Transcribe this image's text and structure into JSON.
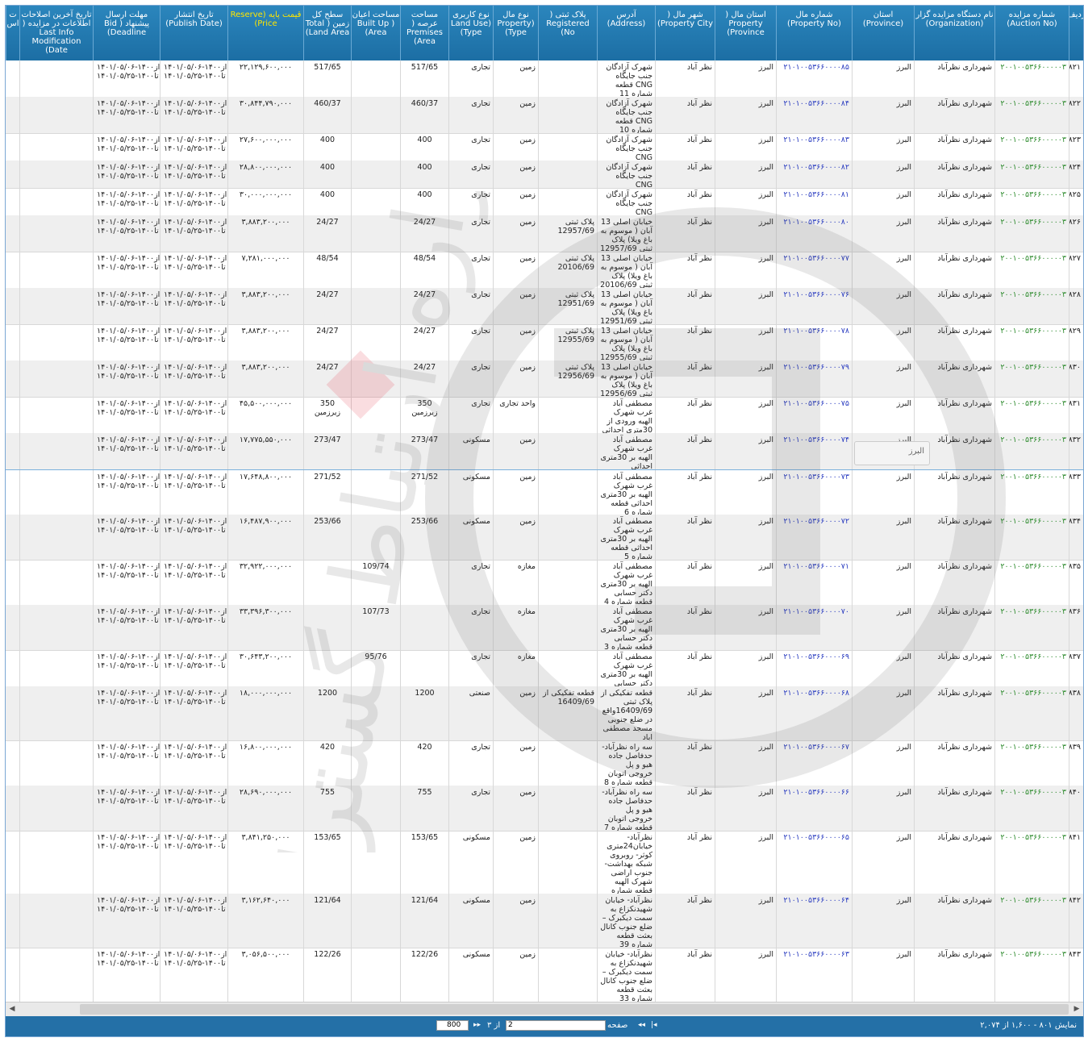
{
  "header": {
    "columns": [
      {
        "key": "radif",
        "label": "ردیف"
      },
      {
        "key": "auction_no",
        "label": "شماره مزایده (Auction No)"
      },
      {
        "key": "organization",
        "label": "نام دستگاه مزایده گزار (Organization)"
      },
      {
        "key": "province",
        "label": "استان (Province)"
      },
      {
        "key": "property_no",
        "label": "شماره مال (Property No)"
      },
      {
        "key": "property_province",
        "label": "استان مال ( Property Province)"
      },
      {
        "key": "property_city",
        "label": "شهر مال ( Property City)"
      },
      {
        "key": "address",
        "label": "آدرس (Address)"
      },
      {
        "key": "registered_no",
        "label": "پلاک ثبتی ( Registered No)"
      },
      {
        "key": "property_type",
        "label": "نوع مال (Property Type)"
      },
      {
        "key": "land_use",
        "label": "نوع کاربری (Land Use Type)"
      },
      {
        "key": "premises_area",
        "label": "مساحت عرصه ( Premises Area)"
      },
      {
        "key": "built_up_area",
        "label": "مساحت اعیان ( Built Up Area)"
      },
      {
        "key": "total_land_area",
        "label": "سطح کل زمین ( Total Land Area)"
      },
      {
        "key": "reserve_price",
        "label": "قیمت پایه (Reserve Price)"
      },
      {
        "key": "publish_date",
        "label": "تاریخ انتشار (Publish Date)"
      },
      {
        "key": "bid_deadline",
        "label": "مهلت ارسال پیشنهاد ( Bid Deadline)"
      },
      {
        "key": "last_modification",
        "label": "تاریخ آخرین اصلاحات اطلاعات در مزایده ( Last Info Modification Date)"
      },
      {
        "key": "extra",
        "label": "ت اس"
      }
    ]
  },
  "rows": [
    {
      "radif": "۸۲۱",
      "auction_no": "۲۰۰۱۰۰۵۳۶۶۰۰۰۰۰۳",
      "organization": "شهرداری نظرآباد",
      "province": "البرز",
      "property_no": "۲۱۰۱۰۰۵۳۶۶۰۰۰۰۸۵",
      "property_province": "البرز",
      "property_city": "نظر آباد",
      "address": "شهرک آزادگان جنب جایگاه CNG قطعه شماره 11",
      "registered_no": "",
      "property_type": "زمین",
      "land_use": "تجاری",
      "premises_area": "517/65",
      "built_up_area": "",
      "total_land_area": "517/65",
      "reserve_price": "۲۲,۱۲۹,۶۰۰,۰۰۰",
      "publish_date": "از۱۴۰۰-۱۴۰۱/۰۵/۰۶\nتا۱۴۰۰-۱۴۰۱/۰۵/۲۵",
      "bid_deadline": "از۱۴۰۰-۱۴۰۱/۰۵/۰۶\nتا۱۴۰۰-۱۴۰۱/۰۵/۲۵",
      "last_modification": ""
    },
    {
      "radif": "۸۲۲",
      "auction_no": "۲۰۰۱۰۰۵۳۶۶۰۰۰۰۰۳",
      "organization": "شهرداری نظرآباد",
      "province": "البرز",
      "property_no": "۲۱۰۱۰۰۵۳۶۶۰۰۰۰۸۴",
      "property_province": "البرز",
      "property_city": "نظر آباد",
      "address": "شهرک آزادگان جنب جایگاه CNG قطعه شماره 10",
      "registered_no": "",
      "property_type": "زمین",
      "land_use": "تجاری",
      "premises_area": "460/37",
      "built_up_area": "",
      "total_land_area": "460/37",
      "reserve_price": "۳۰,۸۴۴,۷۹۰,۰۰۰",
      "publish_date": "از۱۴۰۰-۱۴۰۱/۰۵/۰۶\nتا۱۴۰۰-۱۴۰۱/۰۵/۲۵",
      "bid_deadline": "از۱۴۰۰-۱۴۰۱/۰۵/۰۶\nتا۱۴۰۰-۱۴۰۱/۰۵/۲۵",
      "last_modification": ""
    },
    {
      "radif": "۸۲۳",
      "auction_no": "۲۰۰۱۰۰۵۳۶۶۰۰۰۰۰۳",
      "organization": "شهرداری نظرآباد",
      "province": "البرز",
      "property_no": "۲۱۰۱۰۰۵۳۶۶۰۰۰۰۸۳",
      "property_province": "البرز",
      "property_city": "نظر آباد",
      "address": "شهرک آزادگان جنب جایگاه CNG",
      "registered_no": "",
      "property_type": "زمین",
      "land_use": "تجاری",
      "premises_area": "400",
      "built_up_area": "",
      "total_land_area": "400",
      "reserve_price": "۲۷,۶۰۰,۰۰۰,۰۰۰",
      "publish_date": "از۱۴۰۰-۱۴۰۱/۰۵/۰۶\nتا۱۴۰۰-۱۴۰۱/۰۵/۲۵",
      "bid_deadline": "از۱۴۰۰-۱۴۰۱/۰۵/۰۶\nتا۱۴۰۰-۱۴۰۱/۰۵/۲۵",
      "last_modification": ""
    },
    {
      "radif": "۸۲۴",
      "auction_no": "۲۰۰۱۰۰۵۳۶۶۰۰۰۰۰۳",
      "organization": "شهرداری نظرآباد",
      "province": "البرز",
      "property_no": "۲۱۰۱۰۰۵۳۶۶۰۰۰۰۸۲",
      "property_province": "البرز",
      "property_city": "نظر آباد",
      "address": "شهرک آزادگان جنب جایگاه CNG",
      "registered_no": "",
      "property_type": "زمین",
      "land_use": "تجاری",
      "premises_area": "400",
      "built_up_area": "",
      "total_land_area": "400",
      "reserve_price": "۲۸,۸۰۰,۰۰۰,۰۰۰",
      "publish_date": "از۱۴۰۰-۱۴۰۱/۰۵/۰۶\nتا۱۴۰۰-۱۴۰۱/۰۵/۲۵",
      "bid_deadline": "از۱۴۰۰-۱۴۰۱/۰۵/۰۶\nتا۱۴۰۰-۱۴۰۱/۰۵/۲۵",
      "last_modification": ""
    },
    {
      "radif": "۸۲۵",
      "auction_no": "۲۰۰۱۰۰۵۳۶۶۰۰۰۰۰۳",
      "organization": "شهرداری نظرآباد",
      "province": "البرز",
      "property_no": "۲۱۰۱۰۰۵۳۶۶۰۰۰۰۸۱",
      "property_province": "البرز",
      "property_city": "نظر آباد",
      "address": "شهرک آزادگان جنب جایگاه CNG",
      "registered_no": "",
      "property_type": "زمین",
      "land_use": "تجاری",
      "premises_area": "400",
      "built_up_area": "",
      "total_land_area": "400",
      "reserve_price": "۳۰,۰۰۰,۰۰۰,۰۰۰",
      "publish_date": "از۱۴۰۰-۱۴۰۱/۰۵/۰۶\nتا۱۴۰۰-۱۴۰۱/۰۵/۲۵",
      "bid_deadline": "از۱۴۰۰-۱۴۰۱/۰۵/۰۶\nتا۱۴۰۰-۱۴۰۱/۰۵/۲۵",
      "last_modification": ""
    },
    {
      "radif": "۸۲۶",
      "auction_no": "۲۰۰۱۰۰۵۳۶۶۰۰۰۰۰۳",
      "organization": "شهرداری نظرآباد",
      "province": "البرز",
      "property_no": "۲۱۰۱۰۰۵۳۶۶۰۰۰۰۸۰",
      "property_province": "البرز",
      "property_city": "نظر آباد",
      "address": "خیابان اصلی 13 آبان ( موسوم به باغ ویلا) پلاک ثبتی 12957/69",
      "registered_no": "پلاک ثبتی 12957/69",
      "property_type": "زمین",
      "land_use": "تجاری",
      "premises_area": "24/27",
      "built_up_area": "",
      "total_land_area": "24/27",
      "reserve_price": "۳,۸۸۳,۲۰۰,۰۰۰",
      "publish_date": "از۱۴۰۰-۱۴۰۱/۰۵/۰۶\nتا۱۴۰۰-۱۴۰۱/۰۵/۲۵",
      "bid_deadline": "از۱۴۰۰-۱۴۰۱/۰۵/۰۶\nتا۱۴۰۰-۱۴۰۱/۰۵/۲۵",
      "last_modification": ""
    },
    {
      "radif": "۸۲۷",
      "auction_no": "۲۰۰۱۰۰۵۳۶۶۰۰۰۰۰۳",
      "organization": "شهرداری نظرآباد",
      "province": "البرز",
      "property_no": "۲۱۰۱۰۰۵۳۶۶۰۰۰۰۷۷",
      "property_province": "البرز",
      "property_city": "نظر آباد",
      "address": "خیابان اصلی 13 آبان ( موسوم به باغ ویلا) پلاک ثبتی 20106/69",
      "registered_no": "پلاک ثبتی 20106/69",
      "property_type": "زمین",
      "land_use": "تجاری",
      "premises_area": "48/54",
      "built_up_area": "",
      "total_land_area": "48/54",
      "reserve_price": "۷,۲۸۱,۰۰۰,۰۰۰",
      "publish_date": "از۱۴۰۰-۱۴۰۱/۰۵/۰۶\nتا۱۴۰۰-۱۴۰۱/۰۵/۲۵",
      "bid_deadline": "از۱۴۰۰-۱۴۰۱/۰۵/۰۶\nتا۱۴۰۰-۱۴۰۱/۰۵/۲۵",
      "last_modification": ""
    },
    {
      "radif": "۸۲۸",
      "auction_no": "۲۰۰۱۰۰۵۳۶۶۰۰۰۰۰۳",
      "organization": "شهرداری نظرآباد",
      "province": "البرز",
      "property_no": "۲۱۰۱۰۰۵۳۶۶۰۰۰۰۷۶",
      "property_province": "البرز",
      "property_city": "نظر آباد",
      "address": "خیابان اصلی 13 آبان ( موسوم به باغ ویلا) پلاک ثبتی 12951/69",
      "registered_no": "پلاک ثبتی 12951/69",
      "property_type": "زمین",
      "land_use": "تجاری",
      "premises_area": "24/27",
      "built_up_area": "",
      "total_land_area": "24/27",
      "reserve_price": "۳,۸۸۳,۲۰۰,۰۰۰",
      "publish_date": "از۱۴۰۰-۱۴۰۱/۰۵/۰۶\nتا۱۴۰۰-۱۴۰۱/۰۵/۲۵",
      "bid_deadline": "از۱۴۰۰-۱۴۰۱/۰۵/۰۶\nتا۱۴۰۰-۱۴۰۱/۰۵/۲۵",
      "last_modification": ""
    },
    {
      "radif": "۸۲۹",
      "auction_no": "۲۰۰۱۰۰۵۳۶۶۰۰۰۰۰۳",
      "organization": "شهرداری نظرآباد",
      "province": "البرز",
      "property_no": "۲۱۰۱۰۰۵۳۶۶۰۰۰۰۷۸",
      "property_province": "البرز",
      "property_city": "نظر آباد",
      "address": "خیابان اصلی 13 آبان ( موسوم به باغ ویلا) پلاک ثبتی 12955/69",
      "registered_no": "پلاک ثبتی 12955/69",
      "property_type": "زمین",
      "land_use": "تجاری",
      "premises_area": "24/27",
      "built_up_area": "",
      "total_land_area": "24/27",
      "reserve_price": "۳,۸۸۳,۲۰۰,۰۰۰",
      "publish_date": "از۱۴۰۰-۱۴۰۱/۰۵/۰۶\nتا۱۴۰۰-۱۴۰۱/۰۵/۲۵",
      "bid_deadline": "از۱۴۰۰-۱۴۰۱/۰۵/۰۶\nتا۱۴۰۰-۱۴۰۱/۰۵/۲۵",
      "last_modification": ""
    },
    {
      "radif": "۸۳۰",
      "auction_no": "۲۰۰۱۰۰۵۳۶۶۰۰۰۰۰۳",
      "organization": "شهرداری نظرآباد",
      "province": "البرز",
      "property_no": "۲۱۰۱۰۰۵۳۶۶۰۰۰۰۷۹",
      "property_province": "البرز",
      "property_city": "نظر آباد",
      "address": "خیابان اصلی 13 آبان ( موسوم به باغ ویلا) پلاک ثبتی 12956/69",
      "registered_no": "پلاک ثبتی 12956/69",
      "property_type": "زمین",
      "land_use": "تجاری",
      "premises_area": "24/27",
      "built_up_area": "",
      "total_land_area": "24/27",
      "reserve_price": "۳,۸۸۳,۲۰۰,۰۰۰",
      "publish_date": "از۱۴۰۰-۱۴۰۱/۰۵/۰۶\nتا۱۴۰۰-۱۴۰۱/۰۵/۲۵",
      "bid_deadline": "از۱۴۰۰-۱۴۰۱/۰۵/۰۶\nتا۱۴۰۰-۱۴۰۱/۰۵/۲۵",
      "last_modification": ""
    },
    {
      "radif": "۸۳۱",
      "auction_no": "۲۰۰۱۰۰۵۳۶۶۰۰۰۰۰۳",
      "organization": "شهرداری نظرآباد",
      "province": "البرز",
      "property_no": "۲۱۰۱۰۰۵۳۶۶۰۰۰۰۷۵",
      "property_province": "البرز",
      "property_city": "نظر آباد",
      "address": "مصطفی آباد غرب شهرک الهیه ورودی از 30متری احداثی",
      "registered_no": "",
      "property_type": "واحد تجاری",
      "land_use": "تجاری",
      "premises_area": "350 زیرزمین",
      "built_up_area": "",
      "total_land_area": "350 زیرزمین",
      "reserve_price": "۴۵,۵۰۰,۰۰۰,۰۰۰",
      "publish_date": "از۱۴۰۰-۱۴۰۱/۰۵/۰۶\nتا۱۴۰۰-۱۴۰۱/۰۵/۲۵",
      "bid_deadline": "از۱۴۰۰-۱۴۰۱/۰۵/۰۶\nتا۱۴۰۰-۱۴۰۱/۰۵/۲۵",
      "last_modification": ""
    },
    {
      "radif": "۸۳۲",
      "auction_no": "۲۰۰۱۰۰۵۳۶۶۰۰۰۰۰۳",
      "organization": "شهرداری نظرآباد",
      "province": "البرز",
      "property_no": "۲۱۰۱۰۰۵۳۶۶۰۰۰۰۷۴",
      "property_province": "البرز",
      "property_city": "نظر آباد",
      "address": "مصطفی آباد غرب شهرک الهیه بر 30متری احداثی",
      "registered_no": "",
      "property_type": "زمین",
      "land_use": "مسکونی",
      "premises_area": "273/47",
      "built_up_area": "",
      "total_land_area": "273/47",
      "reserve_price": "۱۷,۷۷۵,۵۵۰,۰۰۰",
      "publish_date": "از۱۴۰۰-۱۴۰۱/۰۵/۰۶\nتا۱۴۰۰-۱۴۰۱/۰۵/۲۵",
      "bid_deadline": "از۱۴۰۰-۱۴۰۱/۰۵/۰۶\nتا۱۴۰۰-۱۴۰۱/۰۵/۲۵",
      "last_modification": ""
    },
    {
      "radif": "۸۳۳",
      "auction_no": "۲۰۰۱۰۰۵۳۶۶۰۰۰۰۰۳",
      "organization": "شهرداری نظرآباد",
      "province": "البرز",
      "property_no": "۲۱۰۱۰۰۵۳۶۶۰۰۰۰۷۳",
      "property_province": "البرز",
      "property_city": "نظر آباد",
      "address": "مصطفی آباد غرب شهرک الهیه بر 30متری احداثی قطعه شماره 6",
      "registered_no": "",
      "property_type": "زمین",
      "land_use": "مسکونی",
      "premises_area": "271/52",
      "built_up_area": "",
      "total_land_area": "271/52",
      "reserve_price": "۱۷,۶۴۸,۸۰۰,۰۰۰",
      "publish_date": "از۱۴۰۰-۱۴۰۱/۰۵/۰۶\nتا۱۴۰۰-۱۴۰۱/۰۵/۲۵",
      "bid_deadline": "از۱۴۰۰-۱۴۰۱/۰۵/۰۶\nتا۱۴۰۰-۱۴۰۱/۰۵/۲۵",
      "last_modification": ""
    },
    {
      "radif": "۸۳۴",
      "auction_no": "۲۰۰۱۰۰۵۳۶۶۰۰۰۰۰۳",
      "organization": "شهرداری نظرآباد",
      "province": "البرز",
      "property_no": "۲۱۰۱۰۰۵۳۶۶۰۰۰۰۷۲",
      "property_province": "البرز",
      "property_city": "نظر آباد",
      "address": "مصطفی آباد غرب شهرک الهیه بر 30متری احداثی قطعه شماره 5",
      "registered_no": "",
      "property_type": "زمین",
      "land_use": "مسکونی",
      "premises_area": "253/66",
      "built_up_area": "",
      "total_land_area": "253/66",
      "reserve_price": "۱۶,۴۸۷,۹۰۰,۰۰۰",
      "publish_date": "از۱۴۰۰-۱۴۰۱/۰۵/۰۶\nتا۱۴۰۰-۱۴۰۱/۰۵/۲۵",
      "bid_deadline": "از۱۴۰۰-۱۴۰۱/۰۵/۰۶\nتا۱۴۰۰-۱۴۰۱/۰۵/۲۵",
      "last_modification": ""
    },
    {
      "radif": "۸۳۵",
      "auction_no": "۲۰۰۱۰۰۵۳۶۶۰۰۰۰۰۳",
      "organization": "شهرداری نظرآباد",
      "province": "البرز",
      "property_no": "۲۱۰۱۰۰۵۳۶۶۰۰۰۰۷۱",
      "property_province": "البرز",
      "property_city": "نظر آباد",
      "address": "مصطفی آباد غرب شهرک الهیه بر 30متری دکتر حسابی قطعه شماره 4",
      "registered_no": "",
      "property_type": "مغازه",
      "land_use": "تجاری",
      "premises_area": "",
      "built_up_area": "109/74",
      "total_land_area": "",
      "reserve_price": "۳۲,۹۲۲,۰۰۰,۰۰۰",
      "publish_date": "از۱۴۰۰-۱۴۰۱/۰۵/۰۶\nتا۱۴۰۰-۱۴۰۱/۰۵/۲۵",
      "bid_deadline": "از۱۴۰۰-۱۴۰۱/۰۵/۰۶\nتا۱۴۰۰-۱۴۰۱/۰۵/۲۵",
      "last_modification": ""
    },
    {
      "radif": "۸۳۶",
      "auction_no": "۲۰۰۱۰۰۵۳۶۶۰۰۰۰۰۳",
      "organization": "شهرداری نظرآباد",
      "province": "البرز",
      "property_no": "۲۱۰۱۰۰۵۳۶۶۰۰۰۰۷۰",
      "property_province": "البرز",
      "property_city": "نظر آباد",
      "address": "مصطفی آباد غرب شهرک الهیه بر 30متری دکتر حسابی قطعه شماره 3",
      "registered_no": "",
      "property_type": "مغازه",
      "land_use": "تجاری",
      "premises_area": "",
      "built_up_area": "107/73",
      "total_land_area": "",
      "reserve_price": "۳۳,۳۹۶,۳۰۰,۰۰۰",
      "publish_date": "از۱۴۰۰-۱۴۰۱/۰۵/۰۶\nتا۱۴۰۰-۱۴۰۱/۰۵/۲۵",
      "bid_deadline": "از۱۴۰۰-۱۴۰۱/۰۵/۰۶\nتا۱۴۰۰-۱۴۰۱/۰۵/۲۵",
      "last_modification": ""
    },
    {
      "radif": "۸۳۷",
      "auction_no": "۲۰۰۱۰۰۵۳۶۶۰۰۰۰۰۳",
      "organization": "شهرداری نظرآباد",
      "province": "البرز",
      "property_no": "۲۱۰۱۰۰۵۳۶۶۰۰۰۰۶۹",
      "property_province": "البرز",
      "property_city": "نظر آباد",
      "address": "مصطفی آباد غرب شهرک الهیه بر 30متری دکتر حسابی",
      "registered_no": "",
      "property_type": "مغازه",
      "land_use": "تجاری",
      "premises_area": "",
      "built_up_area": "95/76",
      "total_land_area": "",
      "reserve_price": "۳۰,۶۴۳,۲۰۰,۰۰۰",
      "publish_date": "از۱۴۰۰-۱۴۰۱/۰۵/۰۶\nتا۱۴۰۰-۱۴۰۱/۰۵/۲۵",
      "bid_deadline": "از۱۴۰۰-۱۴۰۱/۰۵/۰۶\nتا۱۴۰۰-۱۴۰۱/۰۵/۲۵",
      "last_modification": ""
    },
    {
      "radif": "۸۳۸",
      "auction_no": "۲۰۰۱۰۰۵۳۶۶۰۰۰۰۰۳",
      "organization": "شهرداری نظرآباد",
      "province": "البرز",
      "property_no": "۲۱۰۱۰۰۵۳۶۶۰۰۰۰۶۸",
      "property_province": "البرز",
      "property_city": "نظر آباد",
      "address": "قطعه تفکیکی از پلاک ثبتی 16409/69واقع در ضلع جنوبی مسجد مصطفی اباد",
      "registered_no": "قطعه تفکیکی از 16409/69",
      "property_type": "زمین",
      "land_use": "صنعتی",
      "premises_area": "1200",
      "built_up_area": "",
      "total_land_area": "1200",
      "reserve_price": "۱۸,۰۰۰,۰۰۰,۰۰۰",
      "publish_date": "از۱۴۰۰-۱۴۰۱/۰۵/۰۶\nتا۱۴۰۰-۱۴۰۱/۰۵/۲۵",
      "bid_deadline": "از۱۴۰۰-۱۴۰۱/۰۵/۰۶\nتا۱۴۰۰-۱۴۰۱/۰۵/۲۵",
      "last_modification": ""
    },
    {
      "radif": "۸۳۹",
      "auction_no": "۲۰۰۱۰۰۵۳۶۶۰۰۰۰۰۳",
      "organization": "شهرداری نظرآباد",
      "province": "البرز",
      "property_no": "۲۱۰۱۰۰۵۳۶۶۰۰۰۰۶۷",
      "property_province": "البرز",
      "property_city": "نظر آباد",
      "address": "سه راه نظرآباد- حدفاصل جاده هیو و پل خروجی اتوبان قطعه شماره 8",
      "registered_no": "",
      "property_type": "زمین",
      "land_use": "تجاری",
      "premises_area": "420",
      "built_up_area": "",
      "total_land_area": "420",
      "reserve_price": "۱۶,۸۰۰,۰۰۰,۰۰۰",
      "publish_date": "از۱۴۰۰-۱۴۰۱/۰۵/۰۶\nتا۱۴۰۰-۱۴۰۱/۰۵/۲۵",
      "bid_deadline": "از۱۴۰۰-۱۴۰۱/۰۵/۰۶\nتا۱۴۰۰-۱۴۰۱/۰۵/۲۵",
      "last_modification": ""
    },
    {
      "radif": "۸۴۰",
      "auction_no": "۲۰۰۱۰۰۵۳۶۶۰۰۰۰۰۳",
      "organization": "شهرداری نظرآباد",
      "province": "البرز",
      "property_no": "۲۱۰۱۰۰۵۳۶۶۰۰۰۰۶۶",
      "property_province": "البرز",
      "property_city": "نظر آباد",
      "address": "سه راه نظرآباد- حدفاصل جاده هیو و پل خروجی اتوبان قطعه شماره 7",
      "registered_no": "",
      "property_type": "زمین",
      "land_use": "تجاری",
      "premises_area": "755",
      "built_up_area": "",
      "total_land_area": "755",
      "reserve_price": "۲۸,۶۹۰,۰۰۰,۰۰۰",
      "publish_date": "از۱۴۰۰-۱۴۰۱/۰۵/۰۶\nتا۱۴۰۰-۱۴۰۱/۰۵/۲۵",
      "bid_deadline": "از۱۴۰۰-۱۴۰۱/۰۵/۰۶\nتا۱۴۰۰-۱۴۰۱/۰۵/۲۵",
      "last_modification": ""
    },
    {
      "radif": "۸۴۱",
      "auction_no": "۲۰۰۱۰۰۵۳۶۶۰۰۰۰۰۳",
      "organization": "شهرداری نظرآباد",
      "province": "البرز",
      "property_no": "۲۱۰۱۰۰۵۳۶۶۰۰۰۰۶۵",
      "property_province": "البرز",
      "property_city": "نظر آباد",
      "address": "نظرآباد- خیابان24متری کوثر- روبروی شبکه بهداشت- جنوب اراضی شهرک الهیه قطعه شماره 15",
      "registered_no": "",
      "property_type": "زمین",
      "land_use": "مسکونی",
      "premises_area": "153/65",
      "built_up_area": "",
      "total_land_area": "153/65",
      "reserve_price": "۳,۸۴۱,۲۵۰,۰۰۰",
      "publish_date": "از۱۴۰۰-۱۴۰۱/۰۵/۰۶\nتا۱۴۰۰-۱۴۰۱/۰۵/۲۵",
      "bid_deadline": "از۱۴۰۰-۱۴۰۱/۰۵/۰۶\nتا۱۴۰۰-۱۴۰۱/۰۵/۲۵",
      "last_modification": ""
    },
    {
      "radif": "۸۴۲",
      "auction_no": "۲۰۰۱۰۰۵۳۶۶۰۰۰۰۰۳",
      "organization": "شهرداری نظرآباد",
      "province": "البرز",
      "property_no": "۲۱۰۱۰۰۵۳۶۶۰۰۰۰۶۴",
      "property_province": "البرز",
      "property_city": "نظر آباد",
      "address": "نظرآباد- خیابان شهیدنکزاع به سمت دیکبرک – ضلع جنوب کانال بعثت قطعه شماره 39",
      "registered_no": "",
      "property_type": "زمین",
      "land_use": "مسکونی",
      "premises_area": "121/64",
      "built_up_area": "",
      "total_land_area": "121/64",
      "reserve_price": "۳,۱۶۲,۶۴۰,۰۰۰",
      "publish_date": "از۱۴۰۰-۱۴۰۱/۰۵/۰۶\nتا۱۴۰۰-۱۴۰۱/۰۵/۲۵",
      "bid_deadline": "از۱۴۰۰-۱۴۰۱/۰۵/۰۶\nتا۱۴۰۰-۱۴۰۱/۰۵/۲۵",
      "last_modification": ""
    },
    {
      "radif": "۸۴۳",
      "auction_no": "۲۰۰۱۰۰۵۳۶۶۰۰۰۰۰۳",
      "organization": "شهرداری نظرآباد",
      "province": "البرز",
      "property_no": "۲۱۰۱۰۰۵۳۶۶۰۰۰۰۶۳",
      "property_province": "البرز",
      "property_city": "نظر آباد",
      "address": "نظرآباد- خیابان شهیدنکزاع به سمت دیکبرک – ضلع جنوب کانال بعثت قطعه شماره 33",
      "registered_no": "",
      "property_type": "زمین",
      "land_use": "مسکونی",
      "premises_area": "122/26",
      "built_up_area": "",
      "total_land_area": "122/26",
      "reserve_price": "۳,۰۵۶,۵۰۰,۰۰۰",
      "publish_date": "از۱۴۰۰-۱۴۰۱/۰۵/۰۶\nتا۱۴۰۰-۱۴۰۱/۰۵/۲۵",
      "bid_deadline": "از۱۴۰۰-۱۴۰۱/۰۵/۰۶\nتا۱۴۰۰-۱۴۰۱/۰۵/۲۵",
      "last_modification": ""
    }
  ],
  "tooltip": {
    "text": "البرز"
  },
  "pager": {
    "info": "نمایش ۸۰۱ - ۱,۶۰۰ از ۲,۰۷۴",
    "page_label": "صفحه",
    "page_value": "2",
    "of_total": "از ۳",
    "page_size": "800",
    "first_icon": "|◂",
    "prev_icon": "◂◂",
    "next_icon": "▸▸",
    "last_icon": "▸|"
  },
  "watermark": {
    "text": "هزاره ارتباط گستران"
  },
  "colors": {
    "header_bg": "#1c6ea4",
    "price_header": "#ffe600",
    "auction_link": "#2e8b2e",
    "property_link": "#2a3cc0",
    "pager_bg": "#2470a7"
  }
}
